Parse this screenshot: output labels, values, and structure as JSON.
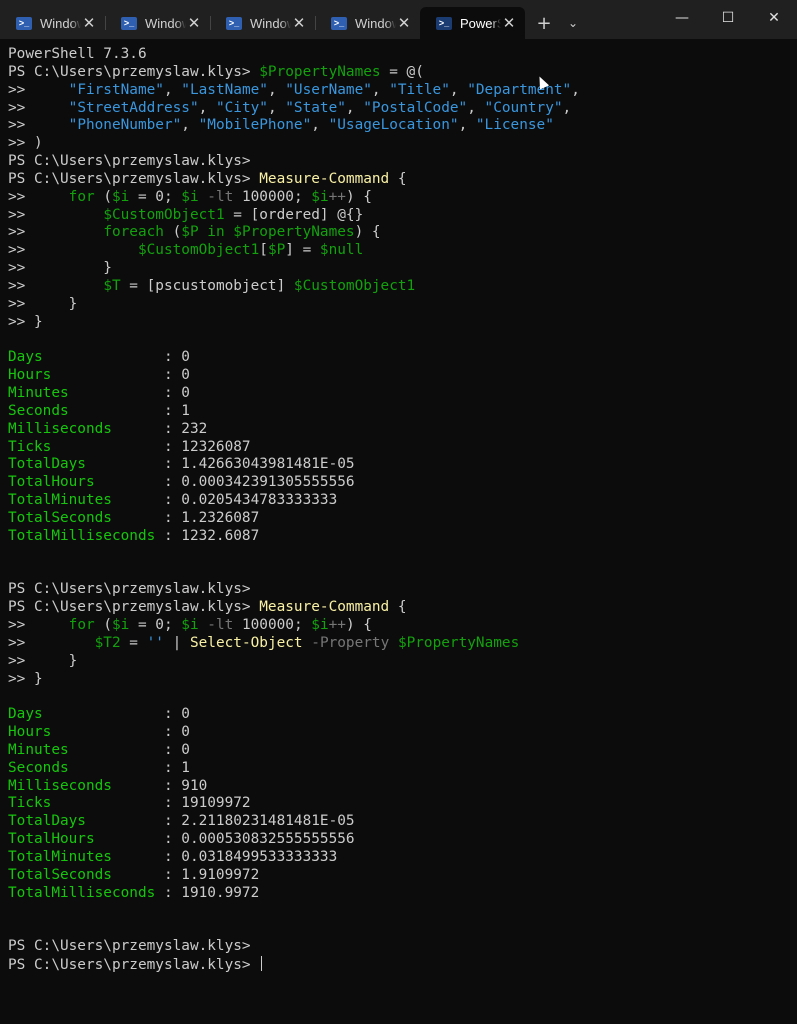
{
  "tabs": [
    {
      "title": "Windows PowerShell",
      "close": "✕",
      "icon": "powershell-icon"
    },
    {
      "title": "Windows PowerShell",
      "close": "✕",
      "icon": "powershell-icon"
    },
    {
      "title": "Windows PowerShell",
      "close": "✕",
      "icon": "powershell-icon"
    },
    {
      "title": "Windows PowerShell",
      "close": "✕",
      "icon": "powershell-icon"
    },
    {
      "title": "PowerShell",
      "close": "✕",
      "icon": "powershell-icon",
      "active": true
    }
  ],
  "tabbar": {
    "new_tab": "+",
    "dropdown": "⌄"
  },
  "window_controls": {
    "minimize": "—",
    "maximize": "☐",
    "close": "✕"
  },
  "colors": {
    "background": "#0c0c0c",
    "default": "#cccccc",
    "variable": "#13a10e",
    "string": "#3a96dd",
    "command": "#f9f1a5",
    "parameter": "#767676",
    "output_label": "#16c60c"
  },
  "terminal_lines": [
    [
      [
        "def",
        "PowerShell 7.3.6"
      ]
    ],
    [
      [
        "def",
        "PS C:\\Users\\przemyslaw.klys> "
      ],
      [
        "var",
        "$PropertyNames"
      ],
      [
        "def",
        " = @("
      ]
    ],
    [
      [
        "def",
        ">>     "
      ],
      [
        "str",
        "\"FirstName\""
      ],
      [
        "def",
        ", "
      ],
      [
        "str",
        "\"LastName\""
      ],
      [
        "def",
        ", "
      ],
      [
        "str",
        "\"UserName\""
      ],
      [
        "def",
        ", "
      ],
      [
        "str",
        "\"Title\""
      ],
      [
        "def",
        ", "
      ],
      [
        "str",
        "\"Department\""
      ],
      [
        "def",
        ","
      ]
    ],
    [
      [
        "def",
        ">>     "
      ],
      [
        "str",
        "\"StreetAddress\""
      ],
      [
        "def",
        ", "
      ],
      [
        "str",
        "\"City\""
      ],
      [
        "def",
        ", "
      ],
      [
        "str",
        "\"State\""
      ],
      [
        "def",
        ", "
      ],
      [
        "str",
        "\"PostalCode\""
      ],
      [
        "def",
        ", "
      ],
      [
        "str",
        "\"Country\""
      ],
      [
        "def",
        ","
      ]
    ],
    [
      [
        "def",
        ">>     "
      ],
      [
        "str",
        "\"PhoneNumber\""
      ],
      [
        "def",
        ", "
      ],
      [
        "str",
        "\"MobilePhone\""
      ],
      [
        "def",
        ", "
      ],
      [
        "str",
        "\"UsageLocation\""
      ],
      [
        "def",
        ", "
      ],
      [
        "str",
        "\"License\""
      ]
    ],
    [
      [
        "def",
        ">> )"
      ]
    ],
    [
      [
        "def",
        "PS C:\\Users\\przemyslaw.klys>"
      ]
    ],
    [
      [
        "def",
        "PS C:\\Users\\przemyslaw.klys> "
      ],
      [
        "cmd",
        "Measure-Command"
      ],
      [
        "def",
        " {"
      ]
    ],
    [
      [
        "def",
        ">>     "
      ],
      [
        "kw",
        "for"
      ],
      [
        "def",
        " ("
      ],
      [
        "var",
        "$i"
      ],
      [
        "def",
        " = 0; "
      ],
      [
        "var",
        "$i"
      ],
      [
        "def",
        " "
      ],
      [
        "op",
        "-lt"
      ],
      [
        "def",
        " 100000; "
      ],
      [
        "var",
        "$i"
      ],
      [
        "op",
        "++"
      ],
      [
        "def",
        ") {"
      ]
    ],
    [
      [
        "def",
        ">>         "
      ],
      [
        "var",
        "$CustomObject1"
      ],
      [
        "def",
        " = [ordered] @{}"
      ]
    ],
    [
      [
        "def",
        ">>         "
      ],
      [
        "kw",
        "foreach"
      ],
      [
        "def",
        " ("
      ],
      [
        "var",
        "$P"
      ],
      [
        "def",
        " "
      ],
      [
        "kw",
        "in"
      ],
      [
        "def",
        " "
      ],
      [
        "var",
        "$PropertyNames"
      ],
      [
        "def",
        ") {"
      ]
    ],
    [
      [
        "def",
        ">>             "
      ],
      [
        "var",
        "$CustomObject1"
      ],
      [
        "def",
        "["
      ],
      [
        "var",
        "$P"
      ],
      [
        "def",
        "] = "
      ],
      [
        "var",
        "$null"
      ]
    ],
    [
      [
        "def",
        ">>         }"
      ]
    ],
    [
      [
        "def",
        ">>         "
      ],
      [
        "var",
        "$T"
      ],
      [
        "def",
        " = [pscustomobject] "
      ],
      [
        "var",
        "$CustomObject1"
      ]
    ],
    [
      [
        "def",
        ">>     }"
      ]
    ],
    [
      [
        "def",
        ">> }"
      ]
    ],
    [
      [
        "def",
        ""
      ]
    ],
    [
      [
        "lbl",
        "Days              "
      ],
      [
        "def",
        ": 0"
      ]
    ],
    [
      [
        "lbl",
        "Hours             "
      ],
      [
        "def",
        ": 0"
      ]
    ],
    [
      [
        "lbl",
        "Minutes           "
      ],
      [
        "def",
        ": 0"
      ]
    ],
    [
      [
        "lbl",
        "Seconds           "
      ],
      [
        "def",
        ": 1"
      ]
    ],
    [
      [
        "lbl",
        "Milliseconds      "
      ],
      [
        "def",
        ": 232"
      ]
    ],
    [
      [
        "lbl",
        "Ticks             "
      ],
      [
        "def",
        ": 12326087"
      ]
    ],
    [
      [
        "lbl",
        "TotalDays         "
      ],
      [
        "def",
        ": 1.42663043981481E-05"
      ]
    ],
    [
      [
        "lbl",
        "TotalHours        "
      ],
      [
        "def",
        ": 0.000342391305555556"
      ]
    ],
    [
      [
        "lbl",
        "TotalMinutes      "
      ],
      [
        "def",
        ": 0.0205434783333333"
      ]
    ],
    [
      [
        "lbl",
        "TotalSeconds      "
      ],
      [
        "def",
        ": 1.2326087"
      ]
    ],
    [
      [
        "lbl",
        "TotalMilliseconds "
      ],
      [
        "def",
        ": 1232.6087"
      ]
    ],
    [
      [
        "def",
        ""
      ]
    ],
    [
      [
        "def",
        ""
      ]
    ],
    [
      [
        "def",
        "PS C:\\Users\\przemyslaw.klys>"
      ]
    ],
    [
      [
        "def",
        "PS C:\\Users\\przemyslaw.klys> "
      ],
      [
        "cmd",
        "Measure-Command"
      ],
      [
        "def",
        " {"
      ]
    ],
    [
      [
        "def",
        ">>     "
      ],
      [
        "kw",
        "for"
      ],
      [
        "def",
        " ("
      ],
      [
        "var",
        "$i"
      ],
      [
        "def",
        " = 0; "
      ],
      [
        "var",
        "$i"
      ],
      [
        "def",
        " "
      ],
      [
        "op",
        "-lt"
      ],
      [
        "def",
        " 100000; "
      ],
      [
        "var",
        "$i"
      ],
      [
        "op",
        "++"
      ],
      [
        "def",
        ") {"
      ]
    ],
    [
      [
        "def",
        ">>        "
      ],
      [
        "var",
        "$T2"
      ],
      [
        "def",
        " = "
      ],
      [
        "str",
        "''"
      ],
      [
        "def",
        " | "
      ],
      [
        "cmd",
        "Select-Object"
      ],
      [
        "def",
        " "
      ],
      [
        "op",
        "-Property"
      ],
      [
        "def",
        " "
      ],
      [
        "var",
        "$PropertyNames"
      ]
    ],
    [
      [
        "def",
        ">>     }"
      ]
    ],
    [
      [
        "def",
        ">> }"
      ]
    ],
    [
      [
        "def",
        ""
      ]
    ],
    [
      [
        "lbl",
        "Days              "
      ],
      [
        "def",
        ": 0"
      ]
    ],
    [
      [
        "lbl",
        "Hours             "
      ],
      [
        "def",
        ": 0"
      ]
    ],
    [
      [
        "lbl",
        "Minutes           "
      ],
      [
        "def",
        ": 0"
      ]
    ],
    [
      [
        "lbl",
        "Seconds           "
      ],
      [
        "def",
        ": 1"
      ]
    ],
    [
      [
        "lbl",
        "Milliseconds      "
      ],
      [
        "def",
        ": 910"
      ]
    ],
    [
      [
        "lbl",
        "Ticks             "
      ],
      [
        "def",
        ": 19109972"
      ]
    ],
    [
      [
        "lbl",
        "TotalDays         "
      ],
      [
        "def",
        ": 2.21180231481481E-05"
      ]
    ],
    [
      [
        "lbl",
        "TotalHours        "
      ],
      [
        "def",
        ": 0.000530832555555556"
      ]
    ],
    [
      [
        "lbl",
        "TotalMinutes      "
      ],
      [
        "def",
        ": 0.0318499533333333"
      ]
    ],
    [
      [
        "lbl",
        "TotalSeconds      "
      ],
      [
        "def",
        ": 1.9109972"
      ]
    ],
    [
      [
        "lbl",
        "TotalMilliseconds "
      ],
      [
        "def",
        ": 1910.9972"
      ]
    ],
    [
      [
        "def",
        ""
      ]
    ],
    [
      [
        "def",
        ""
      ]
    ],
    [
      [
        "def",
        "PS C:\\Users\\przemyslaw.klys>"
      ]
    ],
    [
      [
        "def",
        "PS C:\\Users\\przemyslaw.klys> "
      ]
    ]
  ]
}
